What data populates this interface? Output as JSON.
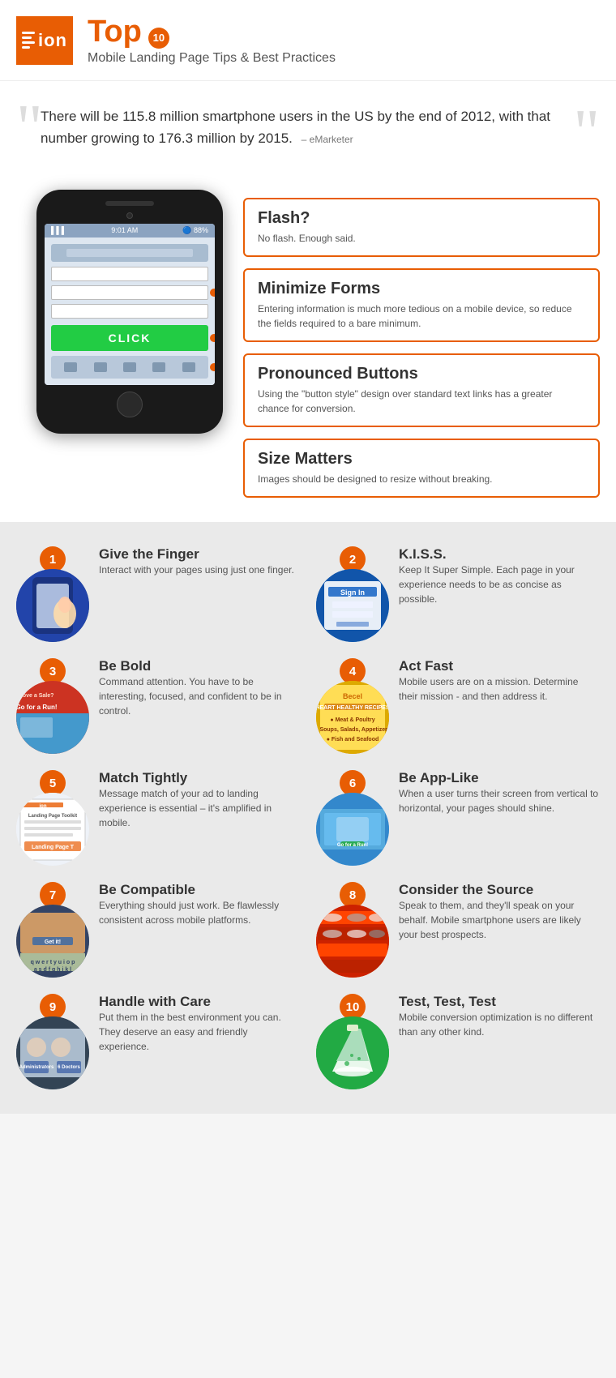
{
  "header": {
    "logo_text": "ion",
    "title_word": "Top",
    "title_number": "10",
    "subtitle": "Mobile Landing Page Tips & Best Practices"
  },
  "quote": {
    "text": "There will be 115.8 million smartphone users in the US by the end of 2012, with that number growing to 176.3 million by 2015.",
    "source": "– eMarketer"
  },
  "phone": {
    "status_time": "9:01 AM",
    "status_signal": "▌▌▌",
    "status_battery": "88%",
    "click_label": "CLICK"
  },
  "callouts": [
    {
      "id": "flash",
      "title": "Flash?",
      "text": "No flash. Enough said."
    },
    {
      "id": "minimize-forms",
      "title": "Minimize Forms",
      "text": "Entering information is much more tedious on a mobile device, so reduce the fields required to a bare minimum."
    },
    {
      "id": "pronounced-buttons",
      "title": "Pronounced Buttons",
      "text": "Using the \"button style\" design over standard text links has a greater chance for conversion."
    },
    {
      "id": "size-matters",
      "title": "Size Matters",
      "text": "Images should be designed to resize without breaking."
    }
  ],
  "tips": [
    {
      "number": "1",
      "title": "Give the Finger",
      "desc": "Interact with your pages using just one finger.",
      "img_class": "tip-img-1"
    },
    {
      "number": "2",
      "title": "K.I.S.S.",
      "desc": "Keep It Super Simple. Each page in your experience needs to be as concise as possible.",
      "img_class": "tip-img-2"
    },
    {
      "number": "3",
      "title": "Be Bold",
      "desc": "Command attention. You have to be interesting, focused, and confident to be in control.",
      "img_class": "tip-img-3"
    },
    {
      "number": "4",
      "title": "Act Fast",
      "desc": "Mobile users are on a mission. Determine their mission - and then address it.",
      "img_class": "tip-img-4"
    },
    {
      "number": "5",
      "title": "Match Tightly",
      "desc": "Message match of your ad to landing experience is essential – it's amplified in mobile.",
      "img_class": "tip-img-5"
    },
    {
      "number": "6",
      "title": "Be App-Like",
      "desc": "When a user turns their screen from vertical to horizontal, your pages should shine.",
      "img_class": "tip-img-6"
    },
    {
      "number": "7",
      "title": "Be Compatible",
      "desc": "Everything should just work. Be flawlessly consistent across mobile platforms.",
      "img_class": "tip-img-7"
    },
    {
      "number": "8",
      "title": "Consider the Source",
      "desc": "Speak to them, and they'll speak on your behalf. Mobile smartphone users are likely your best prospects.",
      "img_class": "tip-img-8"
    },
    {
      "number": "9",
      "title": "Handle with Care",
      "desc": "Put them in the best environment you can. They deserve an easy and friendly experience.",
      "img_class": "tip-img-9"
    },
    {
      "number": "10",
      "title": "Test, Test, Test",
      "desc": "Mobile conversion optimization is no different than any other kind.",
      "img_class": "tip-img-10"
    }
  ]
}
